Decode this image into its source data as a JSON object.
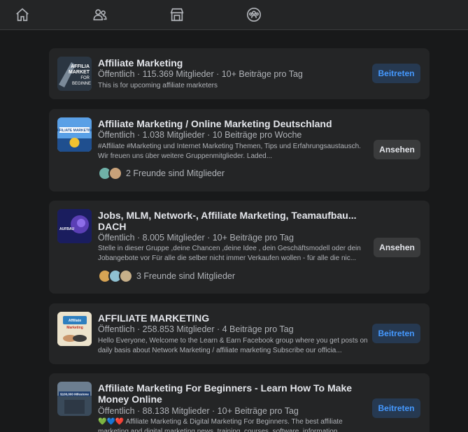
{
  "nav": {
    "icons": [
      "home-icon",
      "friends-icon",
      "marketplace-icon",
      "groups-icon"
    ]
  },
  "groups": [
    {
      "title": "Affiliate Marketing",
      "meta": "Öffentlich · 115.369 Mitglieder · 10+ Beiträge pro Tag",
      "desc": "This is for upcoming affiliate marketers",
      "button": "Beitreten",
      "thumb_text": "AFFILIATE MARKETING FOR BEGINNERS"
    },
    {
      "title": "Affiliate Marketing / Online Marketing Deutschland",
      "meta": "Öffentlich · 1.038 Mitglieder · 10 Beiträge pro Woche",
      "desc": "#Affiliate #Marketing und Internet Marketing Themen, Tips und Erfahrungsaustausch. Wir freuen uns über weitere Gruppenmitglieder. Laded...",
      "friends": "2 Freunde sind Mitglieder",
      "button": "Ansehen",
      "thumb_text": "AFFILIATE MARKETING"
    },
    {
      "title": "Jobs, MLM, Network-, Affiliate Marketing, Teamaufbau... DACH",
      "meta": "Öffentlich · 8.005 Mitglieder · 10+ Beiträge pro Tag",
      "desc": "Stelle in dieser Gruppe ,deine Chancen ,deine Idee , dein Geschäftsmodell oder dein Jobangebote vor Für alle die selber nicht immer Verkaufen wollen - für alle die nic...",
      "friends": "3 Freunde sind Mitglieder",
      "button": "Ansehen",
      "thumb_text": "AUFBAU"
    },
    {
      "title": "AFFILIATE MARKETING",
      "meta": "Öffentlich · 258.853 Mitglieder · 4 Beiträge pro Tag",
      "desc": "Hello Everyone, Welcome to the Learn & Earn Facebook group where you get posts on daily basis about Network Marketing / affiliate marketing Subscribe our officia...",
      "button": "Beitreten",
      "thumb_text": "Affiliate Marketing"
    },
    {
      "title": "Affiliate Marketing For Beginners - Learn How To Make Money Online",
      "meta": "Öffentlich · 88.138 Mitglieder · 10+ Beiträge pro Tag",
      "desc": "💚💙❤️ Affiliate Marketing & Digital Marketing For Beginners. The best affiliate marketing and digital marketing news, training, courses, software, information...",
      "button": "Beitreten",
      "thumb_text": "$100,000 Milestone"
    }
  ],
  "colors": {
    "background": "#18191a",
    "card": "#242526",
    "join_bg": "#263951",
    "join_text": "#4599ff",
    "view_bg": "#3a3b3c"
  }
}
